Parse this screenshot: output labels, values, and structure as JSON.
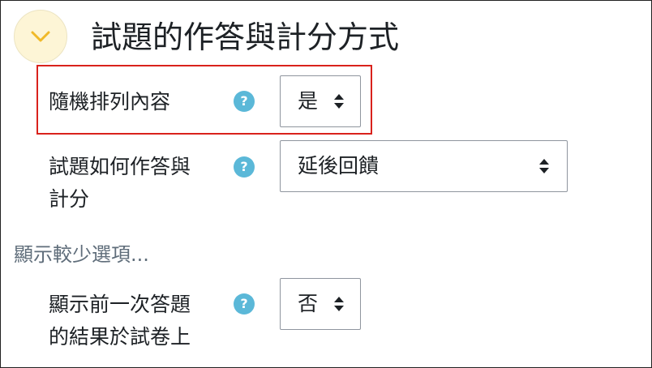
{
  "section": {
    "title": "試題的作答與計分方式",
    "collapse_icon": "chevron-down-icon",
    "accent_color": "#f0b928"
  },
  "fields": [
    {
      "label": "隨機排列內容",
      "value": "是",
      "help_icon": "?"
    },
    {
      "label_lines": [
        "試題如何作答與",
        "計分"
      ],
      "value": "延後回饋",
      "help_icon": "?"
    },
    {
      "label_lines": [
        "顯示前一次答題",
        "的結果於試卷上"
      ],
      "value": "否",
      "help_icon": "?"
    }
  ],
  "show_less_link": "顯示較少選項...",
  "colors": {
    "highlight_border": "#d9221c",
    "help_badge": "#5bb8d8",
    "link": "#5f6d7a"
  }
}
